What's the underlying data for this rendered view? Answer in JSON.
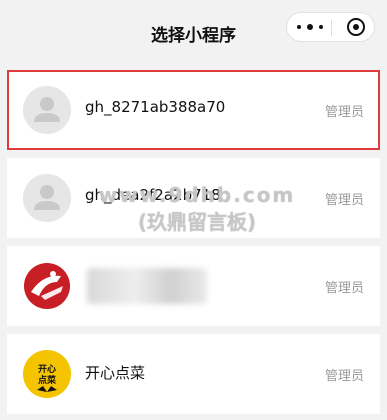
{
  "header": {
    "title": "选择小程序"
  },
  "list": [
    {
      "name": "gh_8271ab388a70",
      "role": "管理员",
      "avatar": "person-icon",
      "selected": true
    },
    {
      "name": "gh_dea2f2a2b718",
      "role": "管理员",
      "avatar": "person-icon",
      "selected": false
    },
    {
      "name": "",
      "role": "管理员",
      "avatar": "red-logo-icon",
      "selected": false
    },
    {
      "name": "开心点菜",
      "role": "管理员",
      "avatar": "kaixin-diancai-logo",
      "selected": false
    }
  ],
  "logo_text": {
    "line1": "开心",
    "line2": "点菜"
  },
  "watermark": {
    "line1": "www.9dhb.com",
    "line2": "(玖鼎留言板)"
  },
  "colors": {
    "selected_border": "#e03b3b",
    "role_text": "#9a9a9a"
  }
}
